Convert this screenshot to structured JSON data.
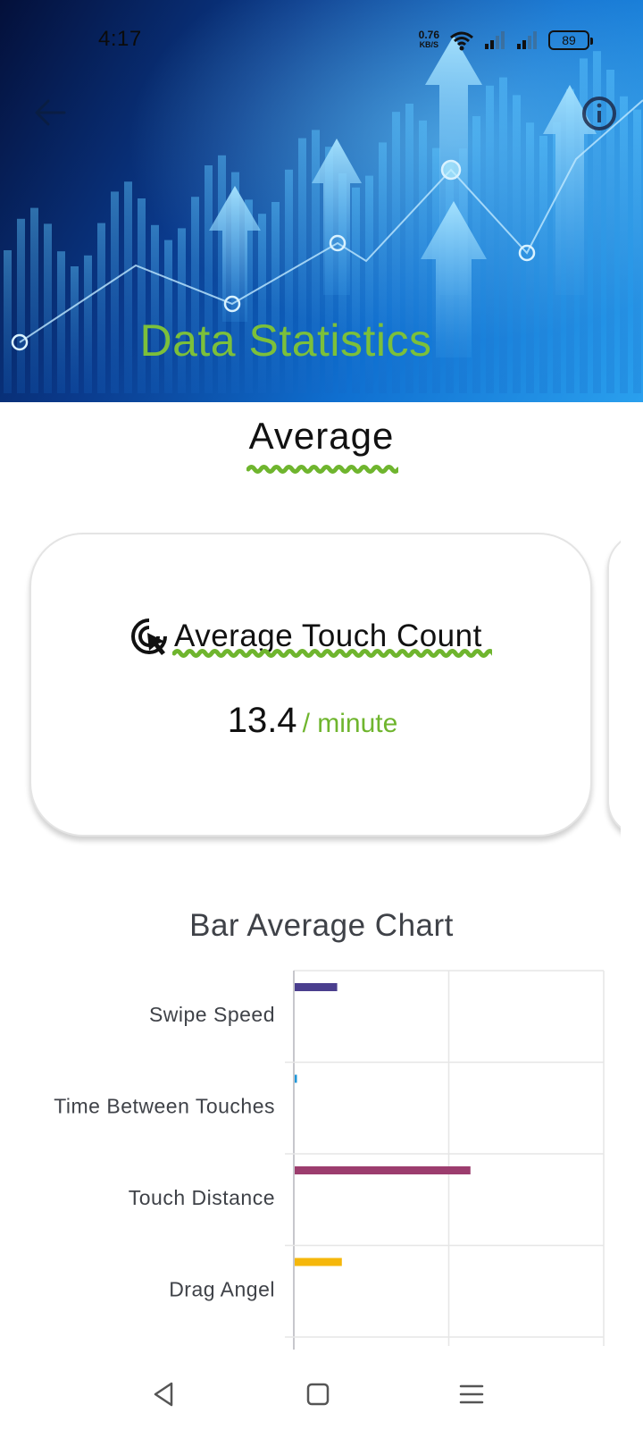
{
  "status_bar": {
    "time": "4:17",
    "net_speed_value": "0.76",
    "net_speed_unit": "KB/S",
    "battery": "89"
  },
  "header": {
    "title": "Data Statistics",
    "title_color": "#7cc03a",
    "back_icon": "arrow-left-icon",
    "info_icon": "info-circle-icon"
  },
  "section": {
    "title": "Average"
  },
  "stat_card": {
    "icon": "touch-pointer-icon",
    "title": "Average Touch Count",
    "value": "13.4",
    "unit": "/ minute"
  },
  "chart_data": {
    "type": "bar",
    "orientation": "horizontal",
    "title": "Bar Average Chart",
    "categories": [
      "Swipe Speed",
      "Time Between Touches",
      "Touch Distance",
      "Drag Angel"
    ],
    "values": [
      14,
      1,
      57,
      15.5
    ],
    "colors": [
      "#4a3e8e",
      "#1e96d8",
      "#9c3d6e",
      "#f5b70b"
    ],
    "xlim": [
      0,
      100
    ],
    "x_gridlines": [
      0,
      50,
      100
    ],
    "grid": true,
    "xlabel": "",
    "ylabel": ""
  },
  "nav": {
    "back_icon": "triangle-back-icon",
    "home_icon": "square-home-icon",
    "menu_icon": "menu-lines-icon"
  }
}
